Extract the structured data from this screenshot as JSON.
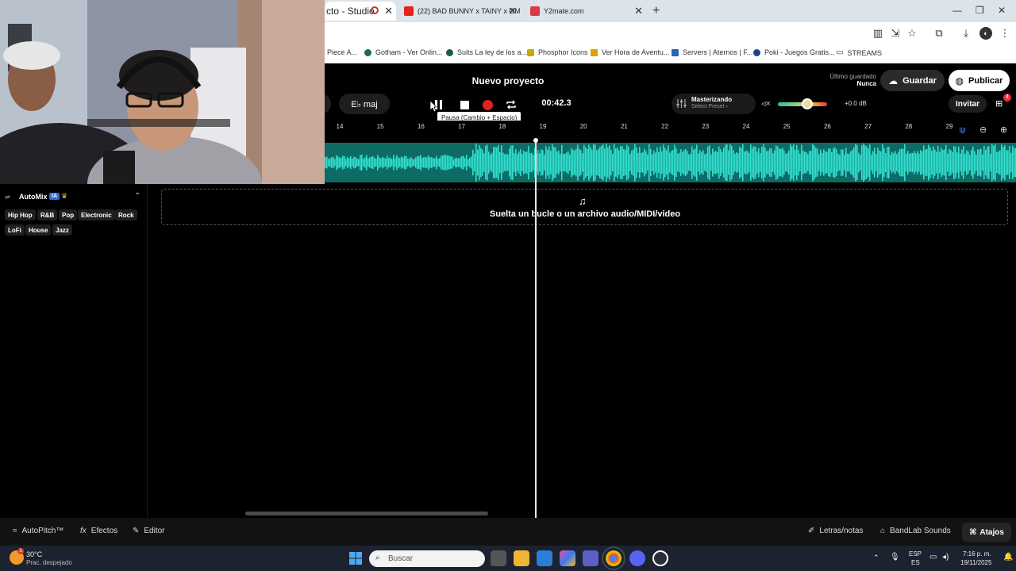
{
  "browser": {
    "tabs": [
      {
        "label": "cto - Studio"
      },
      {
        "label": "(22) BAD BUNNY x TAINY x OM"
      },
      {
        "label": "Y2mate.com"
      }
    ],
    "new_tab": "+",
    "bookmarks": [
      {
        "label": "Piece A..."
      },
      {
        "label": "Gotham - Ver Onlin..."
      },
      {
        "label": "Suits La ley de los a..."
      },
      {
        "label": "Phosphor Icons"
      },
      {
        "label": "Ver Hora de Aventu..."
      },
      {
        "label": "Servers | Aternos | F..."
      },
      {
        "label": "Poki - Juegos Gratis..."
      },
      {
        "label": "STREAMS"
      }
    ]
  },
  "studio": {
    "project_title": "Nuevo proyecto",
    "key": "E♭ maj",
    "time": "00:42.3",
    "tooltip": "Pausa (Cambio + Espacio)",
    "mastering": {
      "title": "Masterizando",
      "preset": "Select Preset"
    },
    "volume_db": "+0.0 dB",
    "volume_level": 0.6,
    "last_saved_label": "Último guardado",
    "last_saved_value": "Nunca",
    "save_label": "Guardar",
    "publish_label": "Publicar",
    "invite_label": "Invitar",
    "notification_count": "4",
    "ruler": [
      "14",
      "15",
      "16",
      "17",
      "18",
      "19",
      "20",
      "21",
      "22",
      "23",
      "24",
      "25",
      "26",
      "27",
      "28",
      "29"
    ],
    "drop_text": "Suelta un bucle o un archivo audio/MIDI/video"
  },
  "automix": {
    "title": "AutoMix",
    "badge": "IA",
    "genres_row1": [
      "Hip Hop",
      "R&B",
      "Pop",
      "Electronic",
      "Rock"
    ],
    "genres_row2": [
      "LoFi",
      "House",
      "Jazz"
    ]
  },
  "bottom": {
    "autopitch": "AutoPitch™",
    "efectos": "Efectos",
    "editor": "Editor",
    "letras": "Letras/notas",
    "sounds": "BandLab Sounds",
    "atajos": "Atajos"
  },
  "taskbar": {
    "weather_temp": "30°C",
    "weather_desc": "Prac. despejado",
    "weather_badge": "1",
    "search_placeholder": "Buscar",
    "lang1": "ESP",
    "lang2": "ES",
    "time": "7:16 p. m.",
    "date": "19/11/2025"
  },
  "colors": {
    "accent": "#25c2b4",
    "waveform": "#30e0cf",
    "record": "#e32020"
  }
}
